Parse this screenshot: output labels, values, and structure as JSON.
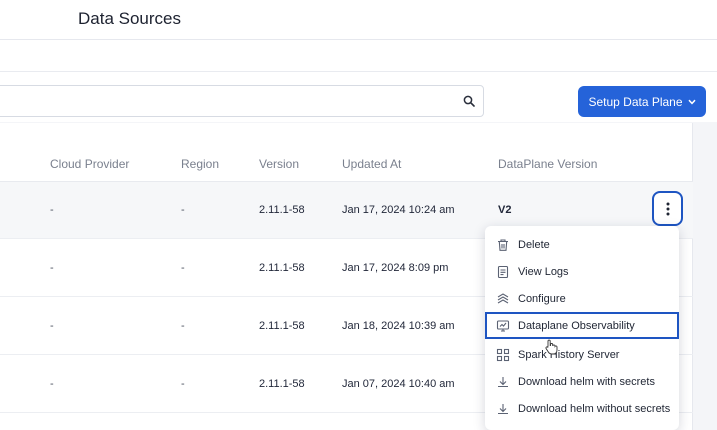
{
  "header": {
    "title": "Data Sources"
  },
  "search": {
    "value": "",
    "placeholder": "",
    "icon": "search-icon"
  },
  "toolbar": {
    "setup_label": "Setup Data Plane",
    "setup_icon": "chevron-down-icon"
  },
  "table": {
    "columns": [
      "Cloud Provider",
      "Region",
      "Version",
      "Updated At",
      "DataPlane Version"
    ],
    "rows": [
      {
        "cloud_provider": "-",
        "region": "-",
        "version": "2.11.1-58",
        "updated_at": "Jan 17, 2024 10:24 am",
        "dataplane_version": "V2"
      },
      {
        "cloud_provider": "-",
        "region": "-",
        "version": "2.11.1-58",
        "updated_at": "Jan 17, 2024 8:09 pm",
        "dataplane_version": ""
      },
      {
        "cloud_provider": "-",
        "region": "-",
        "version": "2.11.1-58",
        "updated_at": "Jan 18, 2024 10:39 am",
        "dataplane_version": ""
      },
      {
        "cloud_provider": "-",
        "region": "-",
        "version": "2.11.1-58",
        "updated_at": "Jan 07, 2024 10:40 am",
        "dataplane_version": ""
      }
    ]
  },
  "menu": {
    "items": [
      {
        "label": "Delete",
        "icon": "trash-icon"
      },
      {
        "label": "View Logs",
        "icon": "document-icon"
      },
      {
        "label": "Configure",
        "icon": "layers-icon"
      },
      {
        "label": "Dataplane Observability",
        "icon": "monitor-icon",
        "selected": true
      },
      {
        "label": "Spark History Server",
        "icon": "nodes-icon"
      },
      {
        "label": "Download helm with secrets",
        "icon": "download-icon"
      },
      {
        "label": "Download helm without secrets",
        "icon": "download-icon"
      }
    ]
  },
  "colors": {
    "accent": "#2563d9",
    "focus_outline": "#1e55c2"
  }
}
